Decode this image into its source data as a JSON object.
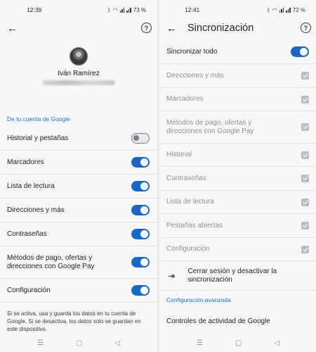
{
  "left": {
    "status": {
      "time": "12:39",
      "battery": "73 %"
    },
    "profile": {
      "name": "Iván Ramírez"
    },
    "section_header": "De tu cuenta de Google",
    "rows": [
      {
        "label": "Historial y pestañas",
        "state": "off"
      },
      {
        "label": "Marcadores",
        "state": "on"
      },
      {
        "label": "Lista de lectura",
        "state": "on"
      },
      {
        "label": "Direcciones y más",
        "state": "on"
      },
      {
        "label": "Contraseñas",
        "state": "on"
      },
      {
        "label": "Métodos de pago, ofertas y direcciones con Google Pay",
        "state": "on"
      },
      {
        "label": "Configuración",
        "state": "on"
      }
    ],
    "note": "Si se activa, usa y guarda los datos en tu cuenta de Google. Si se desactiva, los datos solo se guardan en este dispositivo."
  },
  "right": {
    "status": {
      "time": "12:41",
      "battery": "72 %"
    },
    "title": "Sincronización",
    "sync_all": {
      "label": "Sincronizar todo",
      "state": "on"
    },
    "items": [
      "Direcciones y más",
      "Marcadores",
      "Métodos de pago, ofertas y direcciones con Google Pay",
      "Historial",
      "Contraseñas",
      "Lista de lectura",
      "Pestañas abiertas",
      "Configuración"
    ],
    "signout": "Cerrar sesión y desactivar la sincronización",
    "advanced_header": "Configuración avanzada",
    "activity_controls": "Controles de actividad de Google"
  },
  "icons": {
    "back": "arrow-left-icon",
    "help": "help-circle-icon",
    "signout": "logout-icon",
    "nav_menu": "menu-icon",
    "nav_home": "home-icon",
    "nav_back": "back-triangle-icon"
  },
  "colors": {
    "accent": "#1b66c4",
    "link": "#1a73c9",
    "dim_text": "#8d9096",
    "background": "#f6f7f9"
  }
}
